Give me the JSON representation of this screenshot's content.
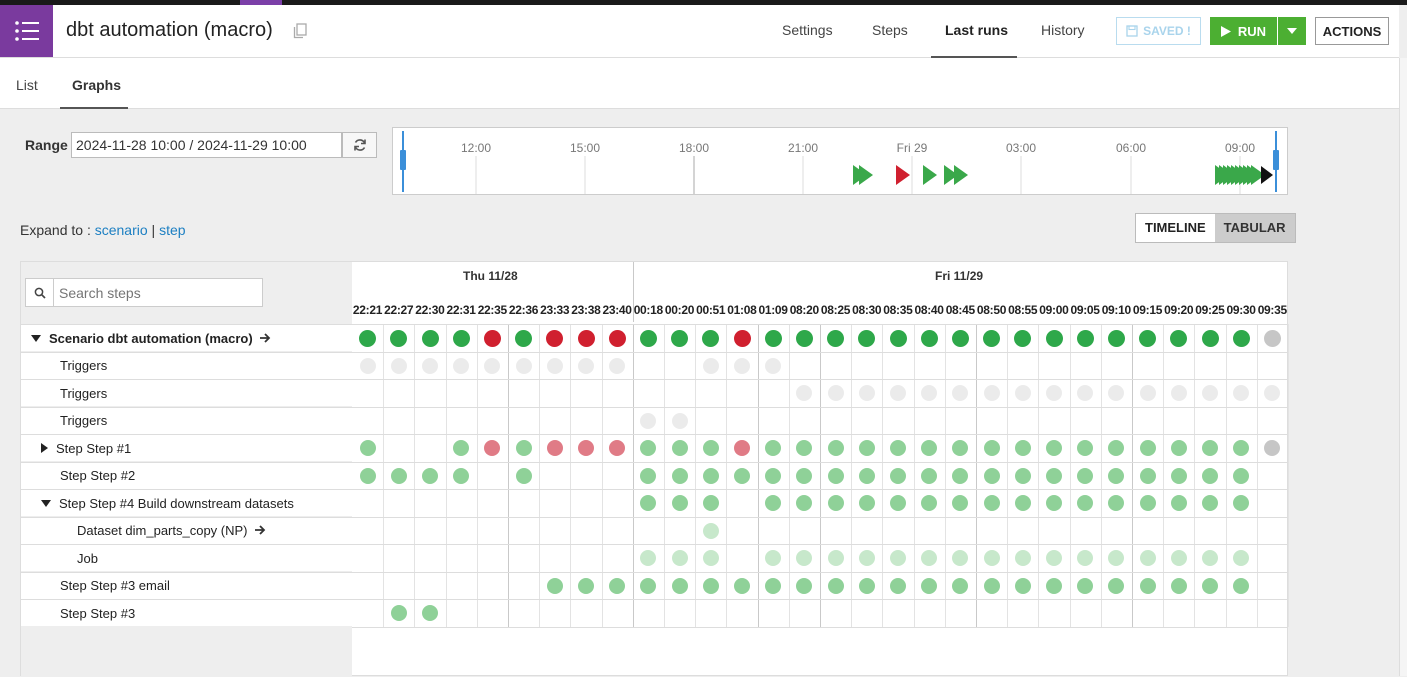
{
  "header": {
    "title": "dbt automation (macro)",
    "nav": [
      "Settings",
      "Steps",
      "Last runs",
      "History"
    ],
    "active_nav": "Last runs",
    "saved_label": "SAVED !",
    "run_label": "RUN",
    "actions_label": "ACTIONS"
  },
  "subnav": {
    "tabs": [
      "List",
      "Graphs"
    ],
    "active": "Graphs"
  },
  "range": {
    "label": "Range",
    "value": "2024-11-28 10:00 / 2024-11-29 10:00"
  },
  "timeline": {
    "ticks": [
      "12:00",
      "15:00",
      "18:00",
      "21:00",
      "Fri 29",
      "03:00",
      "06:00",
      "09:00"
    ]
  },
  "expand": {
    "prefix": "Expand to : ",
    "scenario": "scenario",
    "sep": " | ",
    "step": "step"
  },
  "view_toggle": {
    "timeline": "TIMELINE",
    "tabular": "TABULAR",
    "active": "TABULAR"
  },
  "search": {
    "placeholder": "Search steps"
  },
  "days": [
    {
      "label": "Thu 11/28"
    },
    {
      "label": "Fri 11/29"
    }
  ],
  "times": [
    "22:21",
    "22:27",
    "22:30",
    "22:31",
    "22:35",
    "22:36",
    "23:33",
    "23:38",
    "23:40",
    "00:18",
    "00:20",
    "00:51",
    "01:08",
    "01:09",
    "08:20",
    "08:25",
    "08:30",
    "08:35",
    "08:40",
    "08:45",
    "08:50",
    "08:55",
    "09:00",
    "09:05",
    "09:10",
    "09:15",
    "09:20",
    "09:25",
    "09:30",
    "09:35"
  ],
  "colors": {
    "G": "#2ea84a",
    "R": "#d0202f",
    "g": "#8fd198",
    "r": "#e07b86",
    "l": "#c7e8cb",
    "e": "#ebebeb",
    "x": "#c6c6c6"
  },
  "rows": [
    {
      "label": "Scenario dbt automation (macro)",
      "expand": "down",
      "arrow": true,
      "cells": "GGGGRGRRRGGGRGGGGGGGGGGGGGGGGx"
    },
    {
      "label": "Triggers",
      "cells": "eeeeeeeee..eee................"
    },
    {
      "label": "Triggers",
      "cells": "..............eeeeeeeeeeeeeeee"
    },
    {
      "label": "Triggers",
      "cells": ".........ee..................."
    },
    {
      "label": "Step Step #1",
      "expand": "right",
      "cells": "g..grgrrrgggrggggggggggggggggx"
    },
    {
      "label": "Step Step #2",
      "cells": "gggg.g...gggggggggggggggggggg."
    },
    {
      "label": "Step Step #4 Build downstream datasets",
      "expand": "down",
      "cells": ".........ggg.gggggggggggggggg."
    },
    {
      "label": "Dataset dim_parts_copy (NP)",
      "arrow": true,
      "cells": "...........l.................."
    },
    {
      "label": "Job",
      "cells": ".........lll.llllllllllllllll."
    },
    {
      "label": "Step Step #3 email",
      "cells": "......ggggggggggggggggggggggg."
    },
    {
      "label": "Step Step #3",
      "cells": ".gg..........................."
    }
  ]
}
